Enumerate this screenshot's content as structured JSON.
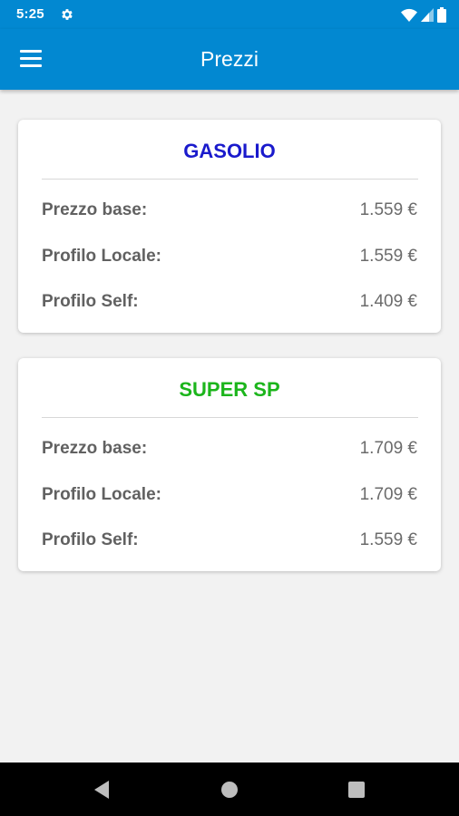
{
  "status_bar": {
    "time": "5:25",
    "icons": [
      "settings-gear-icon",
      "wifi-icon",
      "cellular-signal-icon",
      "battery-icon"
    ]
  },
  "app_bar": {
    "title": "Prezzi",
    "menu_icon": "hamburger-menu-icon"
  },
  "products": [
    {
      "name": "GASOLIO",
      "title_color": "#1a1acc",
      "rows": [
        {
          "label": "Prezzo base:",
          "value": "1.559 €"
        },
        {
          "label": "Profilo Locale:",
          "value": "1.559 €"
        },
        {
          "label": "Profilo Self:",
          "value": "1.409 €"
        }
      ]
    },
    {
      "name": "SUPER SP",
      "title_color": "#1cb51c",
      "rows": [
        {
          "label": "Prezzo base:",
          "value": "1.709 €"
        },
        {
          "label": "Profilo Locale:",
          "value": "1.709 €"
        },
        {
          "label": "Profilo Self:",
          "value": "1.559 €"
        }
      ]
    }
  ],
  "nav_bar": {
    "icons": [
      "back-icon",
      "home-icon",
      "recents-icon"
    ]
  },
  "colors": {
    "primary": "#0288d1",
    "background": "#f2f2f2"
  }
}
